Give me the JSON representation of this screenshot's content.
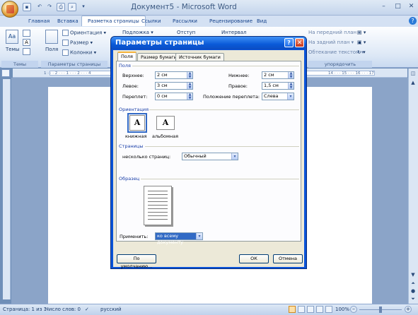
{
  "window": {
    "title": "Документ5 - Microsoft Word",
    "minimize": "–",
    "maximize": "□",
    "close": "✕"
  },
  "ribbon": {
    "tabs": [
      {
        "label": "Главная"
      },
      {
        "label": "Вставка"
      },
      {
        "label": "Разметка страницы"
      },
      {
        "label": "Ссылки"
      },
      {
        "label": "Рассылки"
      },
      {
        "label": "Рецензирование"
      },
      {
        "label": "Вид"
      }
    ],
    "themes_label": "Темы",
    "themes_group": "Темы",
    "fields_label": "Поля",
    "orientation_label": "Ориентация",
    "size_label": "Размер",
    "columns_label": "Колонки",
    "page_setup_group": "Параметры страницы",
    "podlozhka_label": "Подложка",
    "otstup_label": "Отступ",
    "interval_label": "Интервал",
    "front_label": "На передний план",
    "back_label": "На задний план",
    "wrap_label": "Обтекание текстом",
    "arrange_group": "упорядочить"
  },
  "ruler": {
    "left_ticks": "1 · · · 2 · · · 1 · · · 2 · · · 4",
    "right_ticks": "14 · · · 15 · · · 16 · · · 17"
  },
  "statusbar": {
    "page": "Страница: 1 из 1",
    "words": "Число слов: 0",
    "language": "русский",
    "zoom": "100%"
  },
  "dialog": {
    "title": "Параметры страницы",
    "help": "?",
    "close": "✕",
    "tabs": [
      {
        "label": "Поля"
      },
      {
        "label": "Размер бумаги"
      },
      {
        "label": "Источник бумаги"
      }
    ],
    "margins_section": "Поля",
    "top_label": "Верхнее:",
    "top_value": "2 см",
    "bottom_label": "Нижнее:",
    "bottom_value": "2 см",
    "left_label": "Левое:",
    "left_value": "3 см",
    "right_label": "Правое:",
    "right_value": "1,5 см",
    "gutter_label": "Переплет:",
    "gutter_value": "0 см",
    "gutter_pos_label": "Положение переплета:",
    "gutter_pos_value": "Слева",
    "orientation_section": "Ориентация",
    "portrait": "книжная",
    "landscape": "альбомная",
    "pages_section": "Страницы",
    "multiple_pages_label": "несколько страниц:",
    "multiple_pages_value": "Обычный",
    "preview_section": "Образец",
    "apply_label": "Применить:",
    "apply_value": "ко всему документу",
    "default_button": "По умолчанию...",
    "ok_button": "ОК",
    "cancel_button": "Отмена"
  }
}
